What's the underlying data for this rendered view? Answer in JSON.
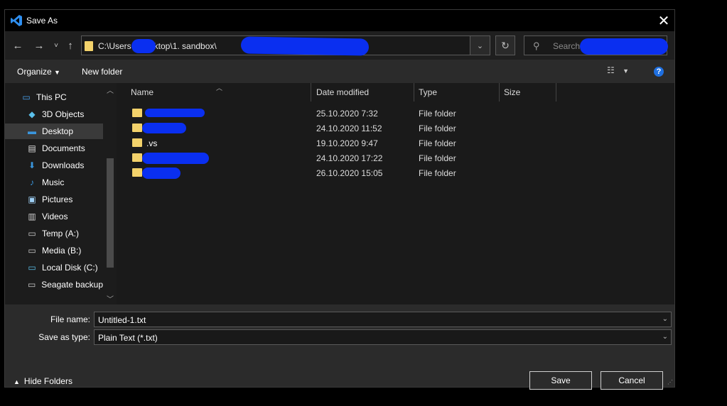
{
  "window": {
    "title": "Save As",
    "close_icon": "close-icon"
  },
  "nav": {
    "back": "←",
    "forward": "→",
    "recent": "˅",
    "up": "↑",
    "address_path": "C:\\Users        r\\Desktop\\1. sandbox\\",
    "address_dropdown": "⌄",
    "refresh": "↻",
    "search_placeholder": "Search"
  },
  "toolbar": {
    "organize_label": "Organize",
    "new_folder_label": "New folder",
    "help": "?"
  },
  "sidebar": {
    "items": [
      {
        "label": "This PC",
        "icon": "pc-icon"
      },
      {
        "label": "3D Objects",
        "icon": "cube-icon"
      },
      {
        "label": "Desktop",
        "icon": "desktop-icon",
        "selected": true
      },
      {
        "label": "Documents",
        "icon": "document-icon"
      },
      {
        "label": "Downloads",
        "icon": "download-icon"
      },
      {
        "label": "Music",
        "icon": "music-icon"
      },
      {
        "label": "Pictures",
        "icon": "picture-icon"
      },
      {
        "label": "Videos",
        "icon": "video-icon"
      },
      {
        "label": "Temp (A:)",
        "icon": "drive-icon"
      },
      {
        "label": "Media (B:)",
        "icon": "drive-icon"
      },
      {
        "label": "Local Disk (C:)",
        "icon": "system-drive-icon"
      },
      {
        "label": "Seagate backup",
        "icon": "drive-icon"
      }
    ]
  },
  "columns": {
    "name": "Name",
    "date": "Date modified",
    "type": "Type",
    "size": "Size"
  },
  "files": [
    {
      "name": "",
      "date": "25.10.2020 7:32",
      "type": "File folder"
    },
    {
      "name": "",
      "date": "24.10.2020 11:52",
      "type": "File folder"
    },
    {
      "name": ".vs",
      "date": "19.10.2020 9:47",
      "type": "File folder"
    },
    {
      "name": "",
      "date": "24.10.2020 17:22",
      "type": "File folder"
    },
    {
      "name": "",
      "date": "26.10.2020 15:05",
      "type": "File folder"
    }
  ],
  "form": {
    "file_name_label": "File name:",
    "file_name_value": "Untitled-1.txt",
    "save_type_label": "Save as type:",
    "save_type_value": "Plain Text (*.txt)"
  },
  "footer": {
    "hide_folders_label": "Hide Folders",
    "save_label": "Save",
    "cancel_label": "Cancel"
  },
  "colors": {
    "accent": "#1e6fe0",
    "folder": "#f3d26b",
    "redaction": "#0a2ff0"
  }
}
